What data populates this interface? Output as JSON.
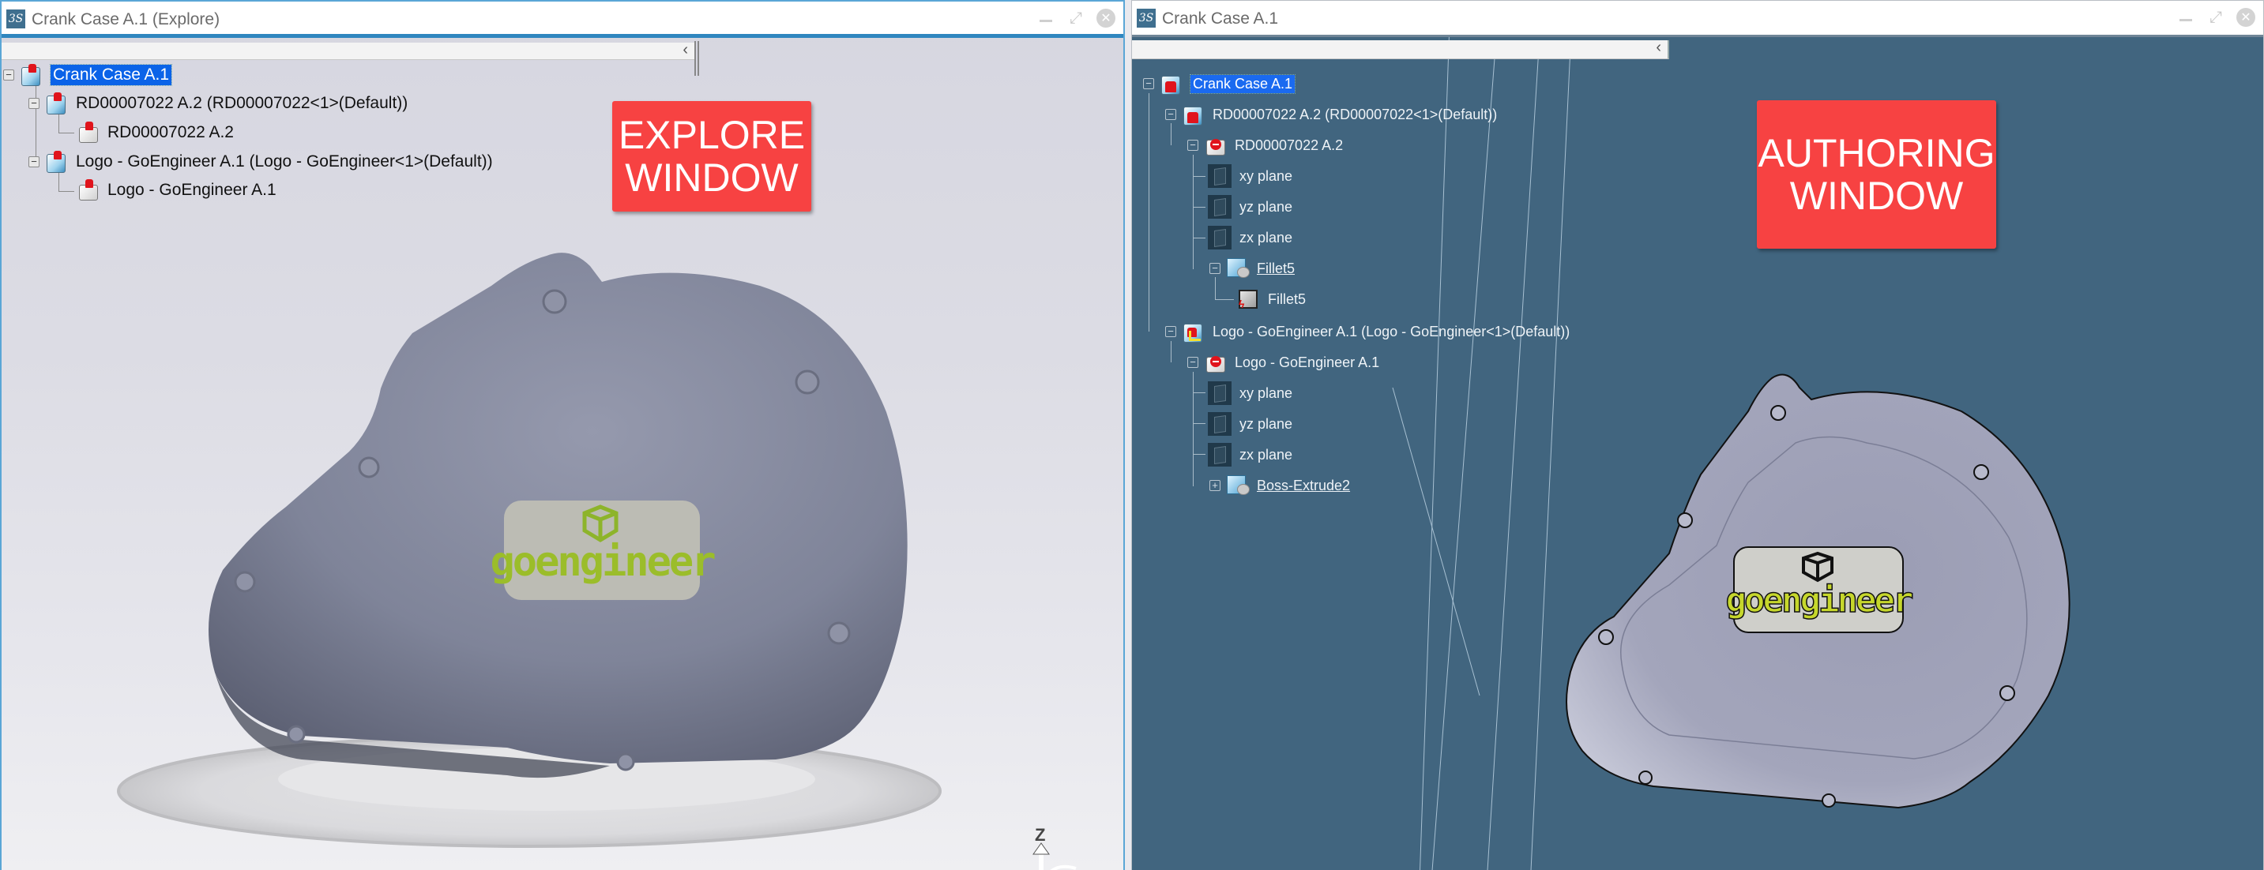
{
  "left_window": {
    "title": "Crank Case A.1 (Explore)",
    "app_logo_glyph": "3S",
    "controls": {
      "minimize": "minimize-icon",
      "maximize": "maximize-icon",
      "close": "close-icon"
    },
    "collapse_glyph": "‹",
    "tree": [
      {
        "label": "Crank Case A.1",
        "level": 0,
        "expander": "−",
        "icon": "locked-product-icon",
        "selected": true
      },
      {
        "label": "RD00007022 A.2 (RD00007022<1>(Default))",
        "level": 1,
        "expander": "−",
        "icon": "locked-product-instance-icon"
      },
      {
        "label": "RD00007022 A.2",
        "level": 2,
        "icon": "locked-part-icon"
      },
      {
        "label": "Logo - GoEngineer A.1 (Logo - GoEngineer<1>(Default))",
        "level": 1,
        "expander": "−",
        "icon": "locked-product-instance-icon"
      },
      {
        "label": "Logo - GoEngineer A.1",
        "level": 2,
        "icon": "locked-part-icon"
      }
    ],
    "callout": {
      "line1": "EXPLORE",
      "line2": "WINDOW"
    },
    "logo_text": "goengineer",
    "axis_label": "Z"
  },
  "right_window": {
    "title": "Crank Case A.1",
    "app_logo_glyph": "3S",
    "controls": {
      "minimize": "minimize-icon",
      "maximize": "maximize-icon",
      "close": "close-icon"
    },
    "collapse_glyph": "‹",
    "tree": [
      {
        "label": "Crank Case A.1",
        "level": 0,
        "expander": "−",
        "icon": "locked-product-icon",
        "selected": true
      },
      {
        "label": "RD00007022 A.2 (RD00007022<1>(Default))",
        "level": 1,
        "expander": "−",
        "icon": "locked-product-instance-icon"
      },
      {
        "label": "RD00007022 A.2",
        "level": 2,
        "expander": "−",
        "icon": "part-no-entry-icon"
      },
      {
        "label": "xy plane",
        "level": 3,
        "icon": "plane-icon"
      },
      {
        "label": "yz plane",
        "level": 3,
        "icon": "plane-icon"
      },
      {
        "label": "zx plane",
        "level": 3,
        "icon": "plane-icon"
      },
      {
        "label": "Fillet5",
        "level": 3,
        "expander": "−",
        "icon": "feature-icon",
        "underlined": true
      },
      {
        "label": "Fillet5",
        "level": 4,
        "icon": "body-icon"
      },
      {
        "label": "Logo - GoEngineer A.1 (Logo - GoEngineer<1>(Default))",
        "level": 1,
        "expander": "−",
        "icon": "product-instance-authoring-icon"
      },
      {
        "label": "Logo - GoEngineer A.1",
        "level": 2,
        "expander": "−",
        "icon": "part-no-entry-icon"
      },
      {
        "label": "xy plane",
        "level": 3,
        "icon": "plane-icon"
      },
      {
        "label": "yz plane",
        "level": 3,
        "icon": "plane-icon"
      },
      {
        "label": "zx plane",
        "level": 3,
        "icon": "plane-icon"
      },
      {
        "label": "Boss-Extrude2",
        "level": 3,
        "expander": "+",
        "icon": "feature-icon",
        "underlined": true
      }
    ],
    "callout": {
      "line1": "AUTHORING",
      "line2": "WINDOW"
    },
    "logo_text": "goengineer"
  },
  "colors": {
    "callout_red": "#f74242",
    "selection_blue": "#0b63e8",
    "authoring_bg": "#41657f",
    "explore_bg": "#d9d9e2",
    "model_gray": "#7f859a",
    "logo_green": "#9bbd2a"
  }
}
